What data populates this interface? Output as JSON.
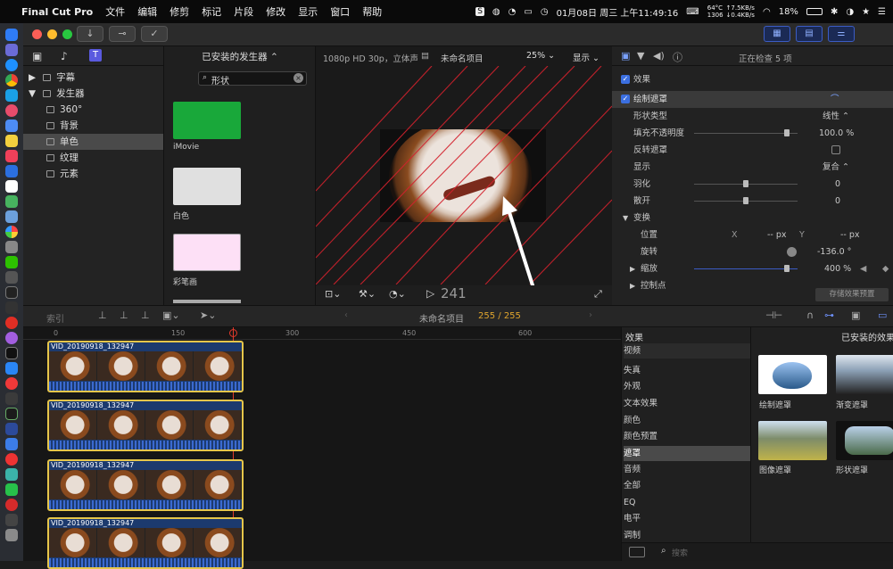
{
  "menubar": {
    "app": "Final Cut Pro",
    "items": [
      "文件",
      "编辑",
      "修剪",
      "标记",
      "片段",
      "修改",
      "显示",
      "窗口",
      "帮助"
    ],
    "net_stats": {
      "cpu": "64°C",
      "fan": "1306",
      "up": "↑7.5KB/s",
      "down": "↓0.4KB/s"
    },
    "clock": "01月08日 周三 上午11:49:16",
    "battery": "18%"
  },
  "browser": {
    "title": "已安装的发生器",
    "search_value": "形状",
    "library": [
      {
        "label": "字幕",
        "level": 0,
        "expanded": false
      },
      {
        "label": "发生器",
        "level": 0,
        "expanded": true
      },
      {
        "label": "360°",
        "level": 1
      },
      {
        "label": "背景",
        "level": 1
      },
      {
        "label": "单色",
        "level": 1,
        "selected": true
      },
      {
        "label": "纹理",
        "level": 1
      },
      {
        "label": "元素",
        "level": 1
      }
    ],
    "generators": [
      {
        "label": "iMovie",
        "color": "#19a83a"
      },
      {
        "label": "白色",
        "color": "#e0e0e0"
      },
      {
        "label": "彩笔画",
        "color": "#fde0f6"
      }
    ]
  },
  "viewer": {
    "format": "1080p HD 30p，立体声",
    "project": "未命名项目",
    "zoom": "25%",
    "display": "显示",
    "timecode": "241"
  },
  "inspector": {
    "title": "正在检查 5 项",
    "section": "效果",
    "effect_name": "绘制遮罩",
    "rows": {
      "shape_type_label": "形状类型",
      "shape_type_value": "线性",
      "fill_opacity_label": "填充不透明度",
      "fill_opacity_value": "100.0 %",
      "fill_opacity_level": 0.9,
      "invert_label": "反转遮罩",
      "display_label": "显示",
      "display_value": "复合",
      "feather_label": "羽化",
      "feather_value": "0",
      "falloff_label": "散开",
      "falloff_value": "0",
      "transform_label": "变换",
      "position_label": "位置",
      "pos_x_label": "X",
      "pos_x_value": "-- px",
      "pos_y_label": "Y",
      "pos_y_value": "-- px",
      "rotation_label": "旋转",
      "rotation_value": "-136.0 °",
      "scale_label": "缩放",
      "scale_value": "400 %",
      "scale_level": 0.9,
      "control_points_label": "控制点"
    },
    "save_preset": "存储效果预置"
  },
  "timeline": {
    "index_label": "索引",
    "project": "未命名项目",
    "position": "255 / 255",
    "ruler": [
      "0",
      "150",
      "300",
      "450",
      "600"
    ],
    "clips": [
      "VID_20190918_132947",
      "VID_20190918_132947",
      "VID_20190918_132947",
      "VID_20190918_132947"
    ]
  },
  "effects_browser": {
    "title": "效果",
    "installed_title": "已安装的效果",
    "categories": [
      {
        "label": "视频",
        "header": true
      },
      {
        "label": "失真"
      },
      {
        "label": "外观"
      },
      {
        "label": "文本效果"
      },
      {
        "label": "颜色"
      },
      {
        "label": "颜色预置"
      },
      {
        "label": "遮罩",
        "selected": true
      },
      {
        "label": "音频",
        "header": true
      },
      {
        "label": "全部"
      },
      {
        "label": "EQ"
      },
      {
        "label": "电平"
      },
      {
        "label": "调制"
      }
    ],
    "items": [
      {
        "label": "绘制遮罩"
      },
      {
        "label": "渐变遮罩"
      },
      {
        "label": "图像遮罩"
      },
      {
        "label": "形状遮罩"
      }
    ],
    "search_placeholder": "搜索"
  }
}
